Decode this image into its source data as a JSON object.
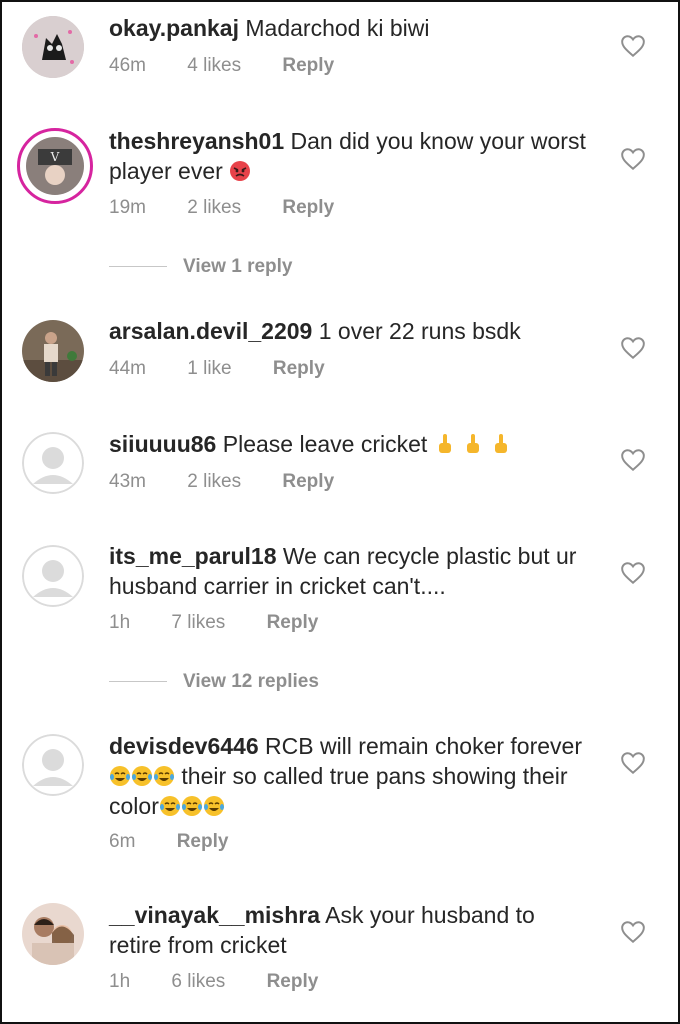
{
  "comments": [
    {
      "username": "okay.pankaj",
      "text": "Madarchod ki biwi",
      "time": "46m",
      "likes": "4 likes",
      "reply": "Reply"
    },
    {
      "username": "theshreyansh01",
      "text": "Dan did you know your worst player ever",
      "time": "19m",
      "likes": "2 likes",
      "reply": "Reply",
      "view_replies": "View 1 reply"
    },
    {
      "username": "arsalan.devil_2209",
      "text": "1 over 22 runs bsdk",
      "time": "44m",
      "likes": "1 like",
      "reply": "Reply"
    },
    {
      "username": "siiuuuu86",
      "text": "Please leave cricket",
      "time": "43m",
      "likes": "2 likes",
      "reply": "Reply"
    },
    {
      "username": "its_me_parul18",
      "text": "We can recycle plastic but ur husband carrier in cricket can't....",
      "time": "1h",
      "likes": "7 likes",
      "reply": "Reply",
      "view_replies": "View 12 replies"
    },
    {
      "username": "devisdev6446",
      "text_a": "RCB will remain choker forever",
      "text_b": "their so called true pans showing their color",
      "time": "6m",
      "reply": "Reply"
    },
    {
      "username": "__vinayak__mishra",
      "text": "Ask your husband to retire from cricket",
      "time": "1h",
      "likes": "6 likes",
      "reply": "Reply"
    }
  ],
  "icons": {
    "like": "heart-outline-icon",
    "angry": "angry-face-emoji",
    "finger": "middle-finger-emoji",
    "laugh": "tears-of-joy-emoji"
  },
  "colors": {
    "text": "#262626",
    "meta": "#8e8e8e",
    "divider": "#c7c7c7",
    "avatar_placeholder": "#dbdbdb"
  }
}
